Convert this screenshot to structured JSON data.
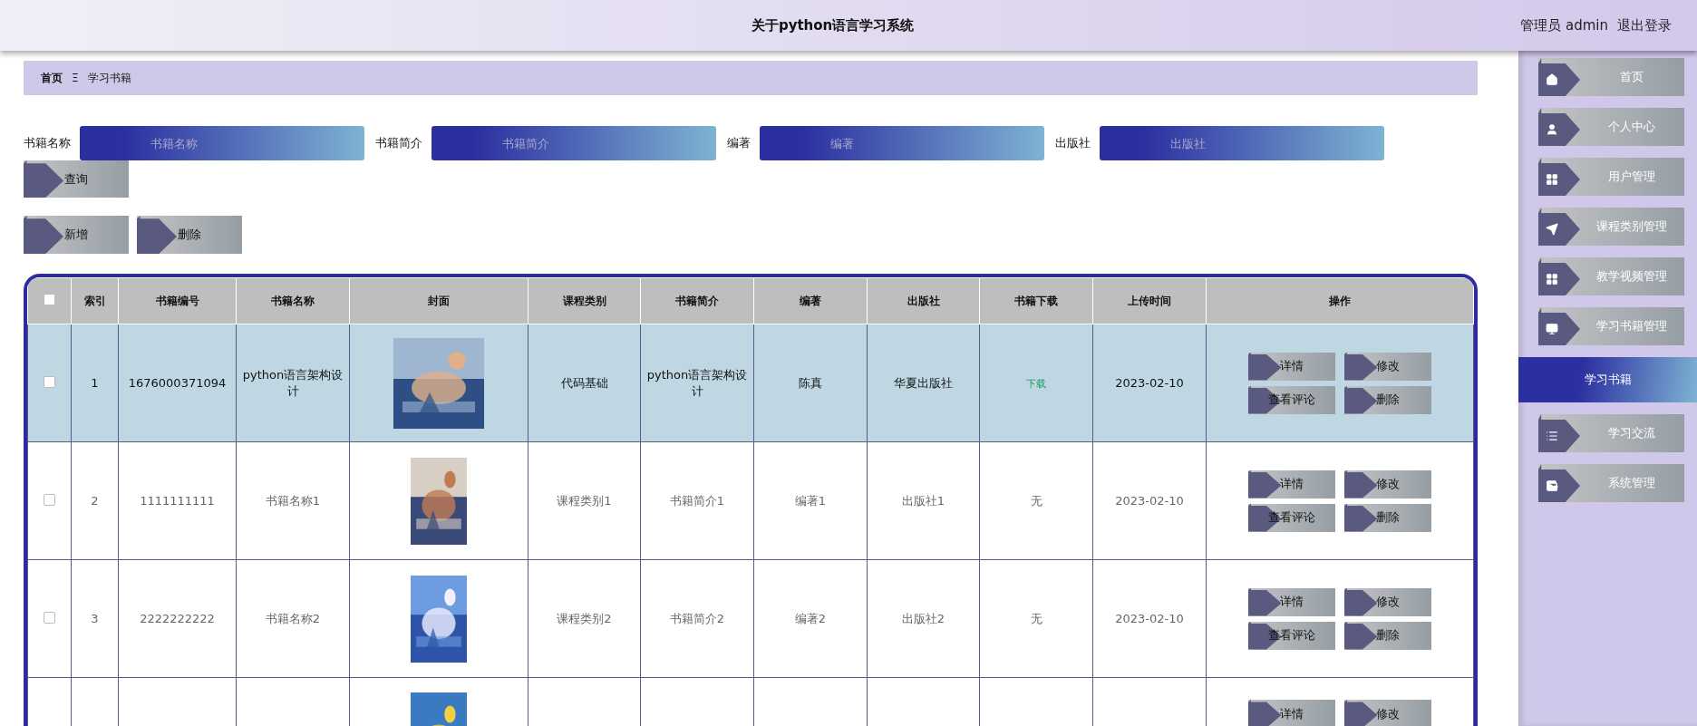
{
  "header": {
    "title": "关于python语言学习系统",
    "user": "管理员 admin",
    "logout": "退出登录"
  },
  "breadcrumb": {
    "home": "首页",
    "separator": "Ξ",
    "current": "学习书籍"
  },
  "search": {
    "fields": [
      {
        "label": "书籍名称",
        "placeholder": "书籍名称"
      },
      {
        "label": "书籍简介",
        "placeholder": "书籍简介"
      },
      {
        "label": "编著",
        "placeholder": "编著"
      },
      {
        "label": "出版社",
        "placeholder": "出版社"
      }
    ],
    "button": "查询"
  },
  "actions": [
    "新增",
    "删除"
  ],
  "table": {
    "select_all_checked": false,
    "columns": [
      "索引",
      "书籍编号",
      "书籍名称",
      "封面",
      "课程类别",
      "书籍简介",
      "编著",
      "出版社",
      "书籍下载",
      "上传时间",
      "操作"
    ],
    "rows": [
      {
        "highlighted": true,
        "checked": false,
        "cells": [
          "1",
          "1676000371094",
          "python语言架构设计"
        ],
        "cover": {
          "kind": "picture"
        },
        "cells2": [
          "代码基础",
          "python语言架构设计",
          "陈真",
          "华夏出版社"
        ],
        "download": {
          "kind": "link",
          "text": "下载"
        },
        "date": "2023-02-10",
        "buttons": [
          "详情",
          "修改",
          "查看评论",
          "删除"
        ]
      },
      {
        "highlighted": false,
        "checked": false,
        "cells": [
          "2",
          "1111111111",
          "书籍名称1"
        ],
        "cover": {
          "kind": "picture"
        },
        "cells2": [
          "课程类别1",
          "书籍简介1",
          "编著1",
          "出版社1"
        ],
        "download": {
          "kind": "none",
          "text": "无"
        },
        "date": "2023-02-10",
        "buttons": [
          "详情",
          "修改",
          "查看评论",
          "删除"
        ]
      },
      {
        "highlighted": false,
        "checked": false,
        "cells": [
          "3",
          "2222222222",
          "书籍名称2"
        ],
        "cover": {
          "kind": "picture"
        },
        "cells2": [
          "课程类别2",
          "书籍简介2",
          "编著2",
          "出版社2"
        ],
        "download": {
          "kind": "none",
          "text": "无"
        },
        "date": "2023-02-10",
        "buttons": [
          "详情",
          "修改",
          "查看评论",
          "删除"
        ]
      },
      {
        "highlighted": false,
        "cover": {
          "kind": "picture"
        },
        "buttons": [
          "详情",
          "修改"
        ]
      }
    ]
  },
  "sidebar": {
    "items": [
      {
        "label": "首页",
        "selected": false
      },
      {
        "label": "个人中心",
        "selected": false
      },
      {
        "label": "用户管理",
        "selected": false
      },
      {
        "label": "课程类别管理",
        "selected": false
      },
      {
        "label": "教学视频管理",
        "selected": false
      },
      {
        "label": "学习书籍管理",
        "selected": false
      },
      {
        "label": "学习书籍",
        "selected": true
      },
      {
        "label": "学习交流",
        "selected": false
      },
      {
        "label": "系统管理",
        "selected": false
      }
    ]
  }
}
